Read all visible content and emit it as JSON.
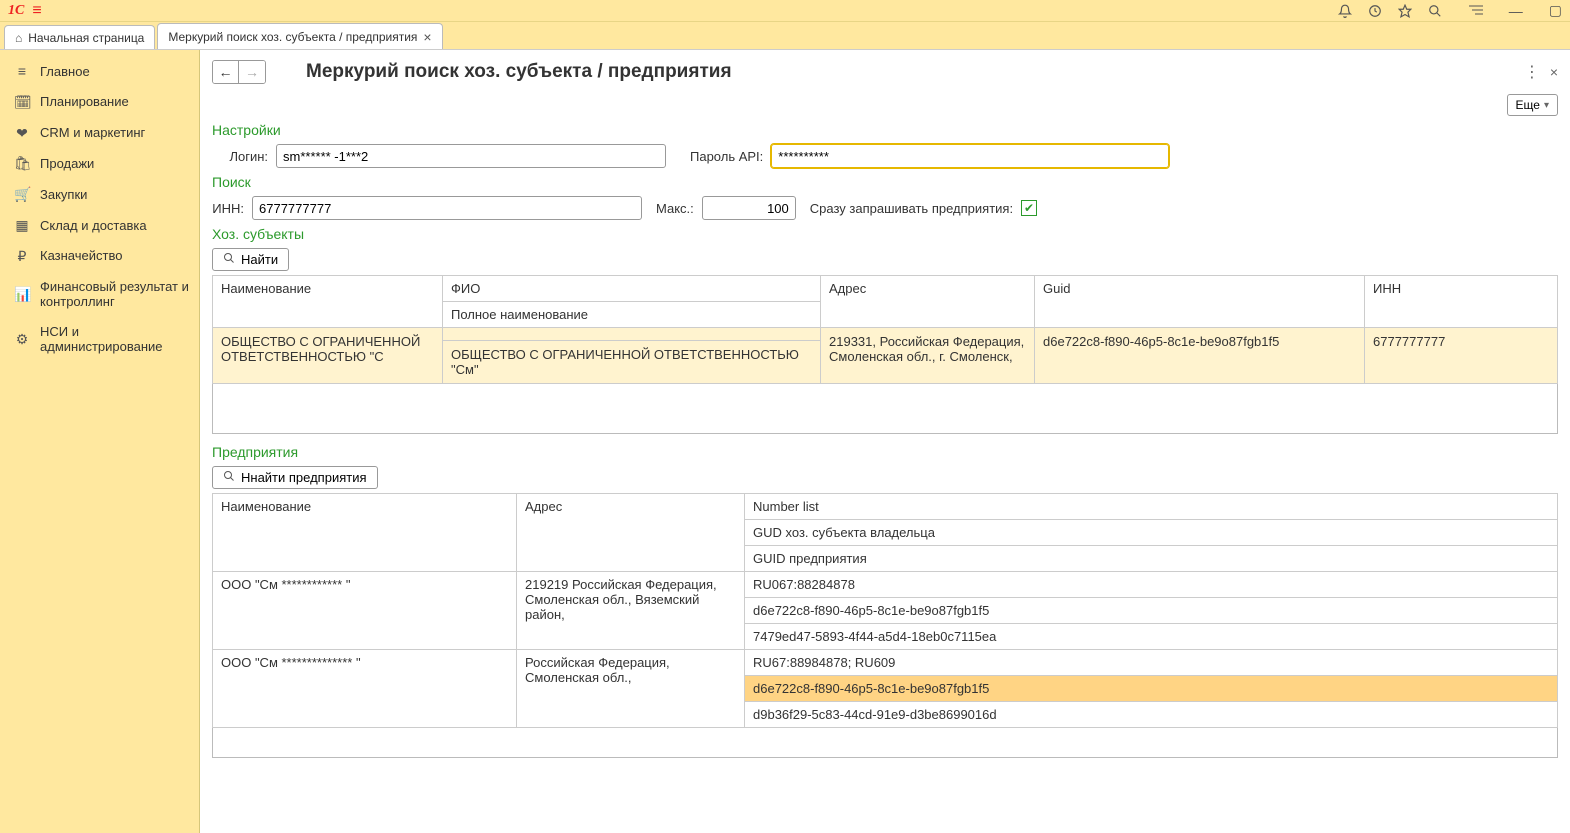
{
  "topbar": {
    "logo": "1C"
  },
  "tabs": {
    "home": "Начальная страница",
    "active": "Меркурий поиск хоз. субъекта / предприятия"
  },
  "sidebar": {
    "items": [
      {
        "icon": "≡",
        "label": "Главное"
      },
      {
        "icon": "🗓",
        "label": "Планирование"
      },
      {
        "icon": "❤",
        "label": "CRM и маркетинг"
      },
      {
        "icon": "🛍",
        "label": "Продажи"
      },
      {
        "icon": "🛒",
        "label": "Закупки"
      },
      {
        "icon": "▦",
        "label": "Склад и доставка"
      },
      {
        "icon": "₽",
        "label": "Казначейство"
      },
      {
        "icon": "📊",
        "label": "Финансовый результат и контроллинг"
      },
      {
        "icon": "⚙",
        "label": "НСИ и администрирование"
      }
    ]
  },
  "page": {
    "title": "Меркурий поиск хоз. субъекта / предприятия",
    "more": "Еще"
  },
  "settings": {
    "heading": "Настройки",
    "login_label": "Логин:",
    "login_value": "sm****** -1***2",
    "password_label": "Пароль API:",
    "password_value": "**********"
  },
  "search": {
    "heading": "Поиск",
    "inn_label": "ИНН:",
    "inn_value": "6777777777",
    "max_label": "Макс.:",
    "max_value": "100",
    "immediate_label": "Сразу запрашивать предприятия:"
  },
  "subjects": {
    "heading": "Хоз. субъекты",
    "find_btn": "Найти",
    "cols": {
      "name": "Наименование",
      "fio": "ФИО",
      "fio_sub": "Полное наименование",
      "addr": "Адрес",
      "guid": "Guid",
      "inn": "ИНН"
    },
    "row": {
      "name": "ОБЩЕСТВО С ОГРАНИЧЕННОЙ ОТВЕТСТВЕННОСТЬЮ \"С",
      "full": "ОБЩЕСТВО С ОГРАНИЧЕННОЙ ОТВЕТСТВЕННОСТЬЮ \"См\"",
      "addr": "219331, Российская Федерация, Смоленская обл., г. Смоленск,",
      "guid": "d6e722c8-f890-46p5-8c1e-be9o87fgb1f5",
      "inn": "6777777777"
    }
  },
  "enterprises": {
    "heading": "Предприятия",
    "find_btn": "Ннайти предприятия",
    "cols": {
      "name": "Наименование",
      "addr": "Адрес",
      "numlist": "Number list",
      "gud": "GUD хоз. субъекта владельца",
      "guid": "GUID предприятия"
    },
    "rows": [
      {
        "name": "ООО \"См  ************  \"",
        "addr": "219219 Российская Федерация, Смоленская обл., Вяземский район,",
        "numlist": "RU067:88284878",
        "gud": "d6e722c8-f890-46p5-8c1e-be9o87fgb1f5",
        "guid": "7479ed47-5893-4f44-a5d4-18eb0c7115ea"
      },
      {
        "name": "ООО \"См  **************  \"",
        "addr": "Российская Федерация, Смоленская обл.,",
        "numlist": "RU67:88984878; RU609",
        "gud": "d6e722c8-f890-46p5-8c1e-be9o87fgb1f5",
        "guid": "d9b36f29-5c83-44cd-91e9-d3be8699016d"
      }
    ]
  }
}
